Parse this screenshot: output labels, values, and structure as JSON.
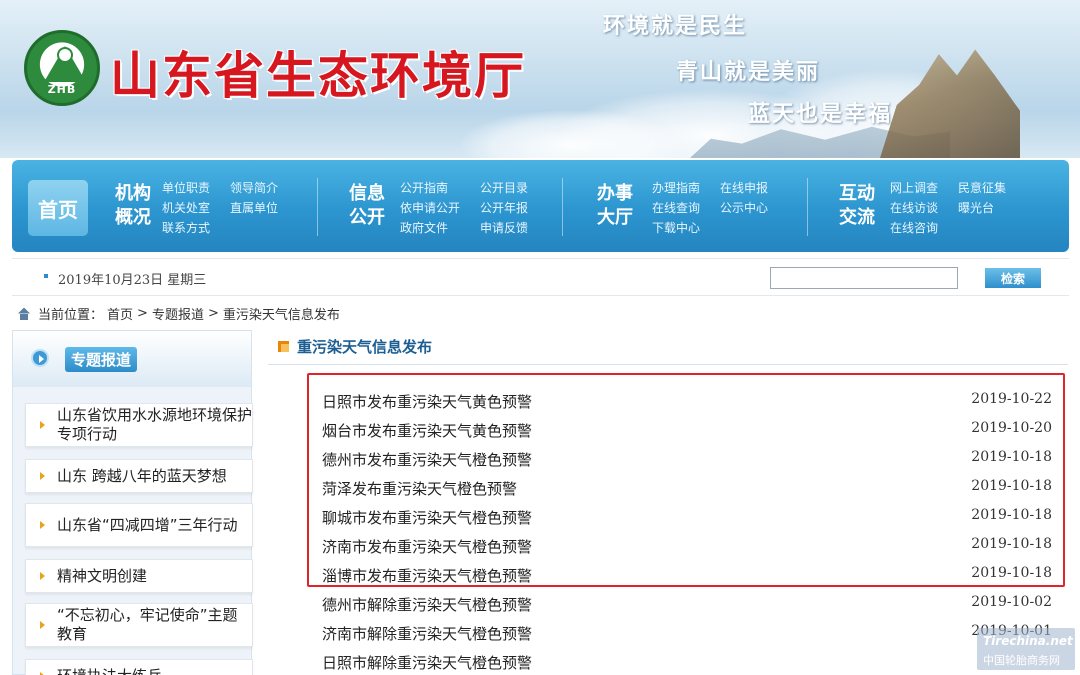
{
  "header": {
    "logo_text": "ZHB",
    "site_title": "山东省生态环境厅",
    "slogans": [
      "环境就是民生",
      "青山就是美丽",
      "蓝天也是幸福"
    ]
  },
  "nav": {
    "home": "首页",
    "groups": [
      {
        "title": "机构概况",
        "links": [
          "单位职责",
          "机关处室",
          "联系方式",
          "领导简介",
          "直属单位"
        ]
      },
      {
        "title": "信息公开",
        "links": [
          "公开指南",
          "依申请公开",
          "政府文件",
          "公开目录",
          "公开年报",
          "申请反馈"
        ]
      },
      {
        "title": "办事大厅",
        "links": [
          "办理指南",
          "在线查询",
          "下载中心",
          "在线申报",
          "公示中心"
        ]
      },
      {
        "title": "互动交流",
        "links": [
          "网上调查",
          "在线访谈",
          "在线咨询",
          "民意征集",
          "曝光台"
        ]
      }
    ]
  },
  "datebar": {
    "date": "2019年10月23日  星期三",
    "search_value": "",
    "search_button": "检索"
  },
  "breadcrumb": {
    "prefix": "当前位置：",
    "items": [
      "首页",
      "专题报道",
      "重污染天气信息发布"
    ],
    "separator": ">"
  },
  "sidebar": {
    "title": "专题报道",
    "items": [
      "山东省饮用水水源地环境保护专项行动",
      "山东 跨越八年的蓝天梦想",
      "山东省“四减四增”三年行动",
      "精神文明创建",
      "“不忘初心，牢记使命”主题教育",
      "环境执法大练兵"
    ]
  },
  "main": {
    "section_title": "重污染天气信息发布",
    "news": [
      {
        "title": "日照市发布重污染天气黄色预警",
        "date": "2019-10-22"
      },
      {
        "title": "烟台市发布重污染天气黄色预警",
        "date": "2019-10-20"
      },
      {
        "title": "德州市发布重污染天气橙色预警",
        "date": "2019-10-18"
      },
      {
        "title": "菏泽发布重污染天气橙色预警",
        "date": "2019-10-18"
      },
      {
        "title": "聊城市发布重污染天气橙色预警",
        "date": "2019-10-18"
      },
      {
        "title": "济南市发布重污染天气橙色预警",
        "date": "2019-10-18"
      },
      {
        "title": "淄博市发布重污染天气橙色预警",
        "date": "2019-10-18"
      },
      {
        "title": "德州市解除重污染天气橙色预警",
        "date": "2019-10-02"
      },
      {
        "title": "济南市解除重污染天气橙色预警",
        "date": "2019-10-01"
      },
      {
        "title": "日照市解除重污染天气橙色预警",
        "date": ""
      }
    ]
  },
  "watermark": {
    "logo": "Tirechina.net",
    "text": "中国轮胎商务网"
  },
  "colors": {
    "title_red": "#d6171f",
    "nav_blue": "#2c95cf",
    "highlight_red": "#e0242b",
    "section_blue": "#1d5f93"
  }
}
